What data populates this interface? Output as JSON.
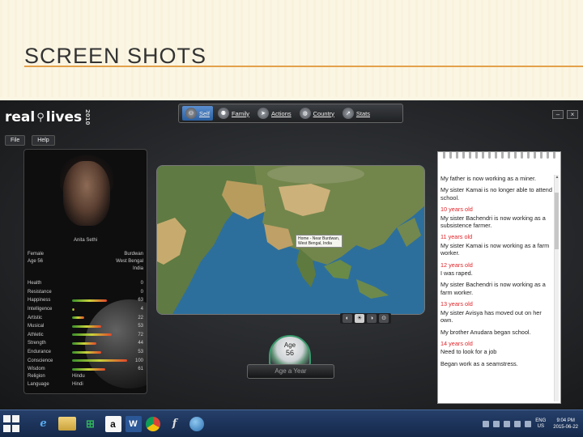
{
  "slide": {
    "title": "SCREEN SHOTS"
  },
  "app": {
    "logo": {
      "word1": "real",
      "word2": "lives",
      "year": "2010"
    },
    "menu": [
      {
        "label": "File"
      },
      {
        "label": "Help"
      }
    ],
    "window_controls": [
      {
        "label": "–"
      },
      {
        "label": "×"
      }
    ],
    "tabs": [
      {
        "label": "Self",
        "icon": "people-icon",
        "active": true
      },
      {
        "label": "Family",
        "icon": "family-icon",
        "active": false
      },
      {
        "label": "Actions",
        "icon": "runner-icon",
        "active": false
      },
      {
        "label": "Country",
        "icon": "globe-icon",
        "active": false
      },
      {
        "label": "Stats",
        "icon": "chart-icon",
        "active": false
      }
    ],
    "profile": {
      "name": "Anita Sethi",
      "gender": "Female",
      "age_label": "Age 56",
      "location": [
        "Burdwan",
        "West Bengal",
        "India"
      ],
      "stats": [
        {
          "label": "Health",
          "value": "0",
          "fill": 0.0
        },
        {
          "label": "Resistance",
          "value": "0",
          "fill": 0.0
        },
        {
          "label": "Happiness",
          "value": "63",
          "fill": 0.63
        },
        {
          "label": "Intelligence",
          "value": "4",
          "fill": 0.04
        },
        {
          "label": "Artistic",
          "value": "22",
          "fill": 0.22
        },
        {
          "label": "Musical",
          "value": "53",
          "fill": 0.53
        },
        {
          "label": "Athletic",
          "value": "72",
          "fill": 0.72
        },
        {
          "label": "Strength",
          "value": "44",
          "fill": 0.44
        },
        {
          "label": "Endurance",
          "value": "53",
          "fill": 0.53
        },
        {
          "label": "Conscience",
          "value": "100",
          "fill": 1.0
        },
        {
          "label": "Wisdom",
          "value": "61",
          "fill": 0.61
        }
      ],
      "religion_label": "Religion",
      "religion": "Hindu",
      "language_label": "Language",
      "language": "Hindi"
    },
    "map": {
      "home_label": "Home - Near Burdwan, West Bengal, India",
      "toolbar": [
        {
          "label": "◐"
        },
        {
          "label": "☀"
        },
        {
          "label": "◑"
        },
        {
          "label": "⊙"
        }
      ]
    },
    "age_widget": {
      "label": "Age",
      "value": "56",
      "button": "Age a Year"
    },
    "log": [
      {
        "type": "text",
        "text": "My father is now working as a miner."
      },
      {
        "type": "text",
        "text": "My sister Kamai is no longer able to attend school."
      },
      {
        "type": "hdr",
        "text": "10 years old"
      },
      {
        "type": "text",
        "text": "My sister Bachendri is now working as a subsistence farmer."
      },
      {
        "type": "hdr",
        "text": "11 years old"
      },
      {
        "type": "text",
        "text": "My sister Kamai is now working as a farm worker."
      },
      {
        "type": "hdr",
        "text": "12 years old"
      },
      {
        "type": "text",
        "text": "I was raped."
      },
      {
        "type": "text",
        "text": "My sister Bachendri is now working as a farm worker."
      },
      {
        "type": "hdr",
        "text": "13 years old"
      },
      {
        "type": "text",
        "text": "My sister Avisya has moved out on her own."
      },
      {
        "type": "text",
        "text": "My brother Anudara began school."
      },
      {
        "type": "hdr",
        "text": "14 years old"
      },
      {
        "type": "text",
        "text": "Need to look for a job"
      },
      {
        "type": "text",
        "text": "Began work as a seamstress."
      }
    ]
  },
  "taskbar": {
    "apps": [
      {
        "name": "internet-explorer-icon",
        "glyph": "e"
      },
      {
        "name": "file-explorer-icon",
        "glyph": ""
      },
      {
        "name": "store-icon",
        "glyph": "⊞"
      },
      {
        "name": "amazon-icon",
        "glyph": "a"
      },
      {
        "name": "word-icon",
        "glyph": "W"
      },
      {
        "name": "chrome-icon",
        "glyph": ""
      },
      {
        "name": "reallives-icon",
        "glyph": "f"
      },
      {
        "name": "browser-globe-icon",
        "glyph": ""
      }
    ],
    "lang": [
      "ENG",
      "US"
    ],
    "time": "9:04 PM",
    "date": "2015-06-22"
  }
}
